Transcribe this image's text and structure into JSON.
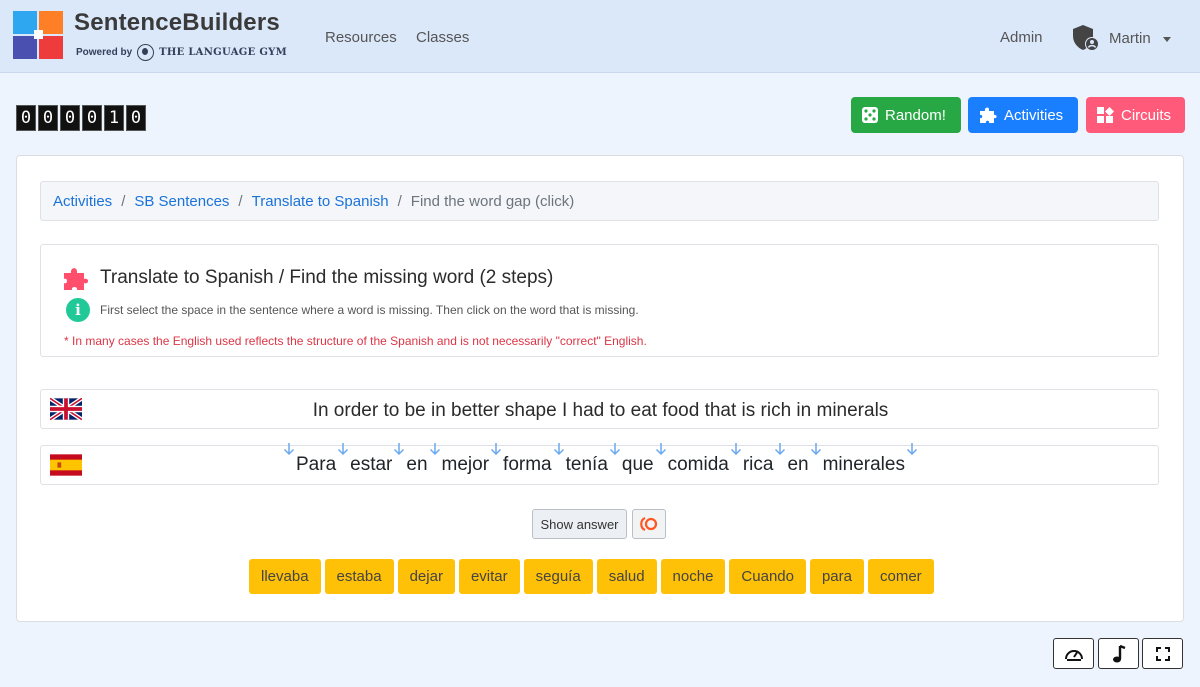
{
  "header": {
    "brand": "SentenceBuilders",
    "powered_by": "Powered by",
    "powered_name": "THE LANGUAGE GYM",
    "nav": [
      "Resources",
      "Classes"
    ],
    "admin": "Admin",
    "user": "Martin"
  },
  "score": [
    "0",
    "0",
    "0",
    "0",
    "1",
    "0"
  ],
  "toolbar": {
    "random": "Random!",
    "activities": "Activities",
    "circuits": "Circuits"
  },
  "breadcrumb": {
    "items": [
      "Activities",
      "SB Sentences",
      "Translate to Spanish"
    ],
    "current": "Find the word gap (click)"
  },
  "info": {
    "title": "Translate to Spanish / Find the missing word (2 steps)",
    "instruction": "First select the space in the sentence where a word is missing. Then click on the word that is missing.",
    "note": "* In many cases the English used reflects the structure of the Spanish and is not necessarily \"correct\" English."
  },
  "english_sentence": "In order to be in better shape I had to eat food that is rich in minerals",
  "spanish_words": [
    "Para",
    "estar",
    "en",
    "mejor",
    "forma",
    "tenía",
    "que",
    "comida",
    "rica",
    "en",
    "minerales"
  ],
  "buttons": {
    "show_answer": "Show answer"
  },
  "options": [
    "llevaba",
    "estaba",
    "dejar",
    "evitar",
    "seguía",
    "salud",
    "noche",
    "Cuando",
    "para",
    "comer"
  ],
  "colors": {
    "random": "#28a745",
    "activities": "#1a7fff",
    "circuits": "#ff5a7a",
    "option": "#ffc107",
    "link": "#1a73d9",
    "arrow": "#6aa9ef"
  }
}
